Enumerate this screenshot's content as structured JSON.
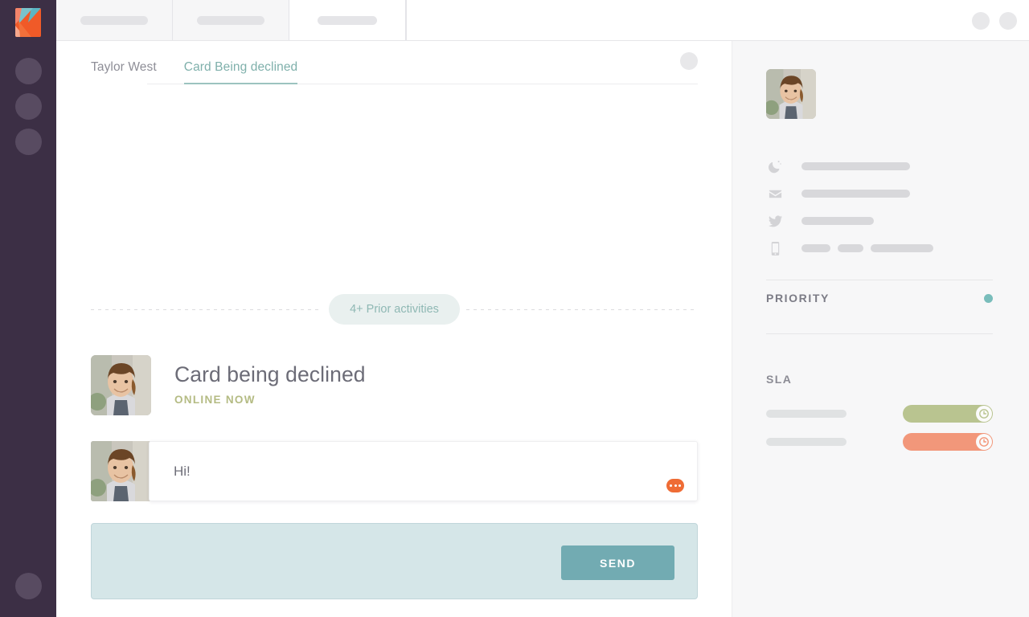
{
  "window": {
    "tabs": [
      {
        "name": "window-tab-1",
        "active": false
      },
      {
        "name": "window-tab-2",
        "active": false
      },
      {
        "name": "window-tab-3",
        "active": true
      }
    ],
    "controls": [
      "window-control-1",
      "window-control-2"
    ]
  },
  "rail": {
    "logo_name": "kayako-logo",
    "nav_items": [
      "rail-nav-1",
      "rail-nav-2",
      "rail-nav-3"
    ],
    "bottom_item": "rail-avatar"
  },
  "conversation": {
    "tabs": [
      {
        "label": "Taylor West",
        "active": false
      },
      {
        "label": "Card Being declined",
        "active": true
      }
    ],
    "divider_label": "4+ Prior activities",
    "header": {
      "title": "Card being declined",
      "status": "ONLINE NOW"
    },
    "messages": [
      {
        "text": "Hi!",
        "menu_icon": "ellipsis-icon"
      }
    ],
    "composer": {
      "value": "",
      "placeholder": "",
      "send_label": "SEND"
    }
  },
  "right_panel": {
    "contact_rows": [
      {
        "icon": "moon-icon",
        "bars": [
          135
        ]
      },
      {
        "icon": "envelope-icon",
        "bars": [
          135
        ]
      },
      {
        "icon": "twitter-icon",
        "bars": [
          90
        ]
      },
      {
        "icon": "mobile-icon",
        "bars": [
          36,
          32,
          78
        ]
      }
    ],
    "priority": {
      "label": "PRIORITY",
      "dot_color": "#79bdbb"
    },
    "sla": {
      "label": "SLA",
      "rows": [
        {
          "color": "#b9c490",
          "fill": 100,
          "icon": "clock-icon"
        },
        {
          "color": "#f2977a",
          "fill": 100,
          "icon": "clock-icon"
        }
      ]
    }
  },
  "colors": {
    "rail_bg": "#3c2f45",
    "accent_teal": "#7fb0ab",
    "accent_orange": "#ef6c35",
    "send_bg": "#72abb2",
    "composer_bg": "#d5e6e8",
    "status_olive": "#b4bb83"
  }
}
